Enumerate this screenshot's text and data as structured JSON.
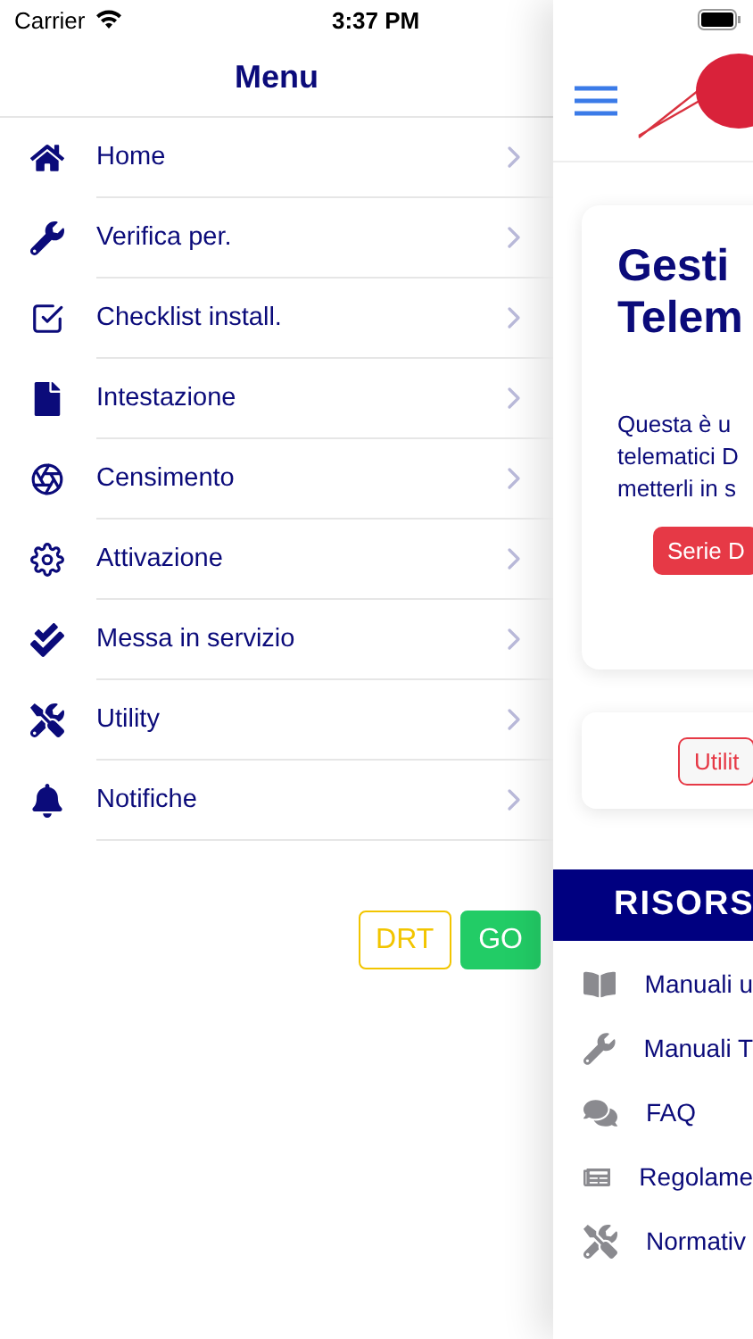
{
  "status_bar": {
    "carrier": "Carrier",
    "time": "3:37 PM"
  },
  "menu": {
    "title": "Menu",
    "items": [
      {
        "label": "Home"
      },
      {
        "label": "Verifica per."
      },
      {
        "label": "Checklist install."
      },
      {
        "label": "Intestazione"
      },
      {
        "label": "Censimento"
      },
      {
        "label": "Attivazione"
      },
      {
        "label": "Messa in servizio"
      },
      {
        "label": "Utility"
      },
      {
        "label": "Notifiche"
      }
    ],
    "buttons": [
      {
        "label": "DRT",
        "kind": "outline"
      },
      {
        "label": "GO",
        "kind": "solid"
      }
    ]
  },
  "main": {
    "hero": {
      "title_lines": [
        "Gesti",
        "Telem"
      ],
      "text_lines": [
        "Questa è u",
        "telematici D",
        "metterli in s"
      ],
      "button": "Serie D"
    },
    "utility_button": "Utilit",
    "resources": {
      "title": "RISORS",
      "items": [
        {
          "label": "Manuali u"
        },
        {
          "label": "Manuali T"
        },
        {
          "label": "FAQ"
        },
        {
          "label": "Regolame"
        },
        {
          "label": "Normativ"
        }
      ]
    }
  }
}
